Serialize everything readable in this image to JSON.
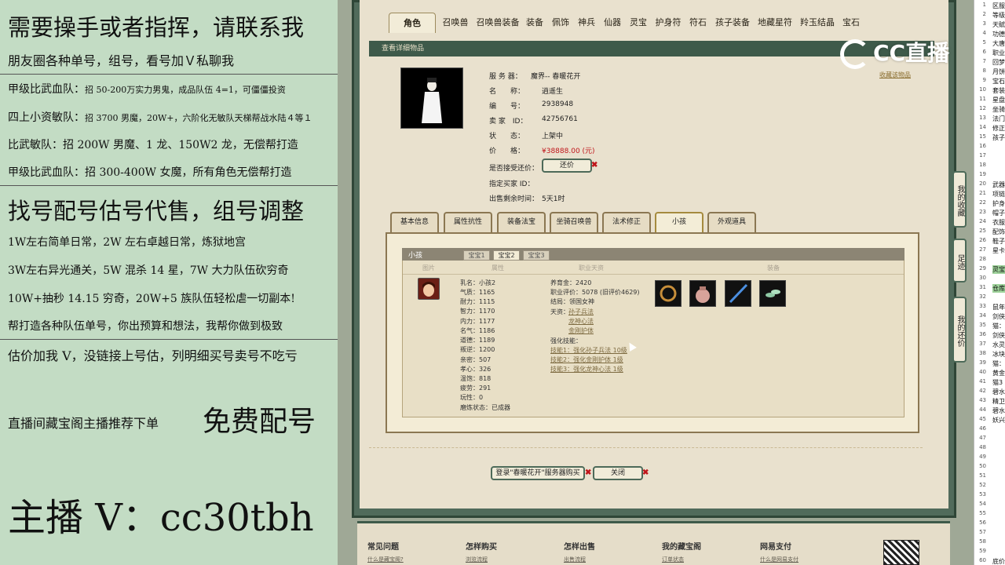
{
  "ad": {
    "title": "需要操手或者指挥，请联系我",
    "subtitle": "朋友圈各种单号，组号，看号加Ｖ私聊我",
    "team1_name": "甲级比武血队：",
    "team1_desc": "招 50-200万实力男鬼，成品队伍 4=1，可僵僵投资",
    "team2_name": "四上小资敏队：",
    "team2_desc": "招 3700 男魔，20W+，六阶化无敏队天梯帮战水陆４等１",
    "team3": "比武敏队：招 200W 男魔、1 龙、150W2 龙，无偿帮打造",
    "team4": "甲级比武血队：招 300-400W 女魔，所有角色无偿帮打造",
    "service": "找号配号估号代售，组号调整",
    "s1": "1W左右简单日常，2W 左右卓越日常，炼狱地宫",
    "s2": "3W左右异光通关，5W 混杀 14 星，7W 大力队伍砍穷奇",
    "s3": "10W+抽秒 14.15 穷奇，20W+5 族队伍轻松虐一切副本!",
    "s4": "帮打造各种队伍单号，你出预算和想法，我帮你做到极致",
    "price": "估价加我 V，没链接上号估，列明细买号卖号不吃亏",
    "free_a": "直播间藏宝阁主播推荐下单",
    "free_b": "免费配号",
    "anchor": "主播 V：cc30tbh"
  },
  "tabs": [
    "角色",
    "召唤兽",
    "召唤兽装备",
    "装备",
    "佩饰",
    "神兵",
    "仙器",
    "灵宝",
    "护身符",
    "符石",
    "孩子装备",
    "地藏星符",
    "羚玉结晶",
    "宝石"
  ],
  "section_title": "查看详细物品",
  "fav_link": "收藏该物品",
  "item": {
    "server_label": "服 务 器：",
    "server": "魔界-- 春暖花开",
    "name_label": "名　　称：",
    "name": "逍遥生",
    "id_label": "编　　号：",
    "id": "2938948",
    "seller_label": "卖 家　ID：",
    "seller": "42756761",
    "status_label": "状　　态：",
    "status": "上架中",
    "price_label": "价　　格：",
    "price": "¥38888.00 (元)",
    "counter_label": "是否接受还价：",
    "counter_btn": "还价",
    "buyer_label": "指定买家 ID：",
    "remain_label": "出售剩余时间：",
    "remain": "5天1时"
  },
  "detail_tabs": [
    "基本信息",
    "属性抗性",
    "装备法宝",
    "坐骑召唤兽",
    "法术修正",
    "小孩",
    "外观道具"
  ],
  "child": {
    "title": "小孩",
    "tabs": [
      "宝宝1",
      "宝宝2",
      "宝宝3"
    ],
    "col_pic": "图片",
    "col_attr": "属性",
    "col_talent": "职业天资",
    "col_equip": "装备",
    "stats": [
      "乳名：小孩2",
      "气质：1165",
      "耐力：1115",
      "智力：1170",
      "内力：1177",
      "名气：1186",
      "道德：1189",
      "叛逆：1200",
      "亲密：507",
      "孝心：326",
      "温饱：818",
      "疲劳：291",
      "玩性：0",
      "磨炼状态：已成器"
    ],
    "nurture": "养育金：2420",
    "eval": "职业评价：5078 (旧评价4629)",
    "ending": "结局：领国女神",
    "talent_label": "天资：",
    "talents": [
      "孙子兵法",
      "龙神心法",
      "金刚护体"
    ],
    "skill_label": "强化技能：",
    "skills": [
      "技能1：强化孙子兵法 10级",
      "技能2：强化金刚护体 1级",
      "技能3：强化龙神心法 1级"
    ]
  },
  "bottom_buttons": [
    "登录\"春暖花开\"服务器购买",
    "关闭"
  ],
  "side_buttons": [
    "我的收藏",
    "足迹",
    "我的还价"
  ],
  "footer": {
    "heads": [
      "常见问题",
      "怎样购买",
      "怎样出售",
      "我的藏宝阁",
      "网易支付"
    ],
    "links": [
      "什么是藏宝阁?",
      "浏览流程",
      "出售流程",
      "订单状态",
      "什么是网易支付"
    ]
  },
  "logo_text": "CC直播",
  "sheet": {
    "rows": [
      "1",
      "2",
      "3",
      "4",
      "5",
      "6",
      "7",
      "8",
      "9",
      "10",
      "11",
      "12",
      "13",
      "14",
      "15",
      "16",
      "17",
      "18",
      "19",
      "20",
      "21",
      "22",
      "23",
      "24",
      "25",
      "26",
      "27",
      "28",
      "29",
      "30",
      "31",
      "32",
      "33",
      "34",
      "35",
      "36",
      "37",
      "38",
      "39",
      "40",
      "41",
      "42",
      "43",
      "44",
      "45",
      "46",
      "47",
      "48",
      "49",
      "50",
      "51",
      "52",
      "53",
      "54",
      "55",
      "56",
      "57",
      "58",
      "59",
      "60"
    ],
    "cells": [
      "区服",
      "等级",
      "天赋",
      "功德",
      "大唐",
      "职业",
      "回梦",
      "月饼",
      "宝石",
      "套装",
      "星盘",
      "坐骑",
      "法门",
      "修正",
      "孩子",
      "",
      "",
      "",
      "",
      "武器",
      "项链",
      "护身",
      "帽子",
      "衣服",
      "配饰",
      "鞋子",
      "星卡",
      "",
      "灵宝",
      "",
      "仓库",
      "",
      "鼠年",
      "剑侠",
      "猫：",
      "剑侠",
      "水灵",
      "冰块",
      "猫：",
      "黄金",
      "猫3",
      "碧水",
      "精卫",
      "碧水",
      "妖兴",
      "",
      "",
      "",
      "",
      "",
      "",
      "",
      "",
      "",
      "",
      "",
      "",
      "",
      "",
      "底价"
    ]
  }
}
